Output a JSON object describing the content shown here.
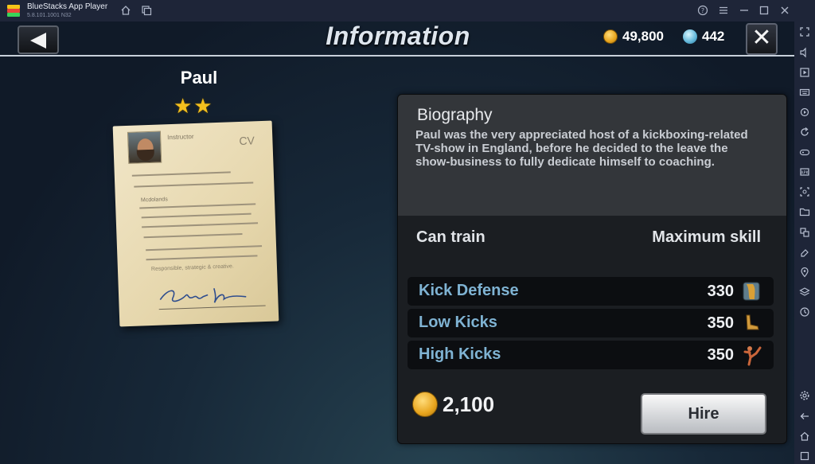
{
  "window": {
    "app_title": "BlueStacks App Player",
    "version": "5.8.101.1001  N32",
    "icons": [
      "home-icon",
      "multi-instance-icon",
      "help-icon",
      "menu-icon",
      "minimize-icon",
      "maximize-icon",
      "close-icon"
    ]
  },
  "sidebar": {
    "icons": [
      "fullscreen-icon",
      "volume-icon",
      "media-icon",
      "keyboard-icon",
      "rotate-icon",
      "sync-icon",
      "gamepad-icon",
      "apk-icon",
      "screenshot-icon",
      "folder-icon",
      "multi-window-icon",
      "eraser-icon",
      "location-icon",
      "layers-icon",
      "clock-icon",
      "settings-icon",
      "back-icon",
      "home-icon",
      "recent-apps-icon"
    ]
  },
  "header": {
    "title": "Information",
    "coins": "49,800",
    "gems": "442"
  },
  "character": {
    "name": "Paul",
    "stars": "★★",
    "cv": {
      "role": "Instructor",
      "mark": "CV",
      "company": "Mcdolands",
      "motto": "Responsible, strategic & creative."
    }
  },
  "biography": {
    "title": "Biography",
    "text": "Paul was the very appreciated host of a kickboxing-related TV-show in England, before he decided to the leave the show-business to fully dedicate himself to coaching."
  },
  "skills": {
    "col_can_train": "Can train",
    "col_max_skill": "Maximum skill",
    "rows": [
      {
        "name": "Kick Defense",
        "value": "330",
        "icon": "shin-guard-icon"
      },
      {
        "name": "Low Kicks",
        "value": "350",
        "icon": "low-kick-icon"
      },
      {
        "name": "High Kicks",
        "value": "350",
        "icon": "high-kick-icon"
      }
    ]
  },
  "hire": {
    "price": "2,100",
    "button_label": "Hire"
  }
}
